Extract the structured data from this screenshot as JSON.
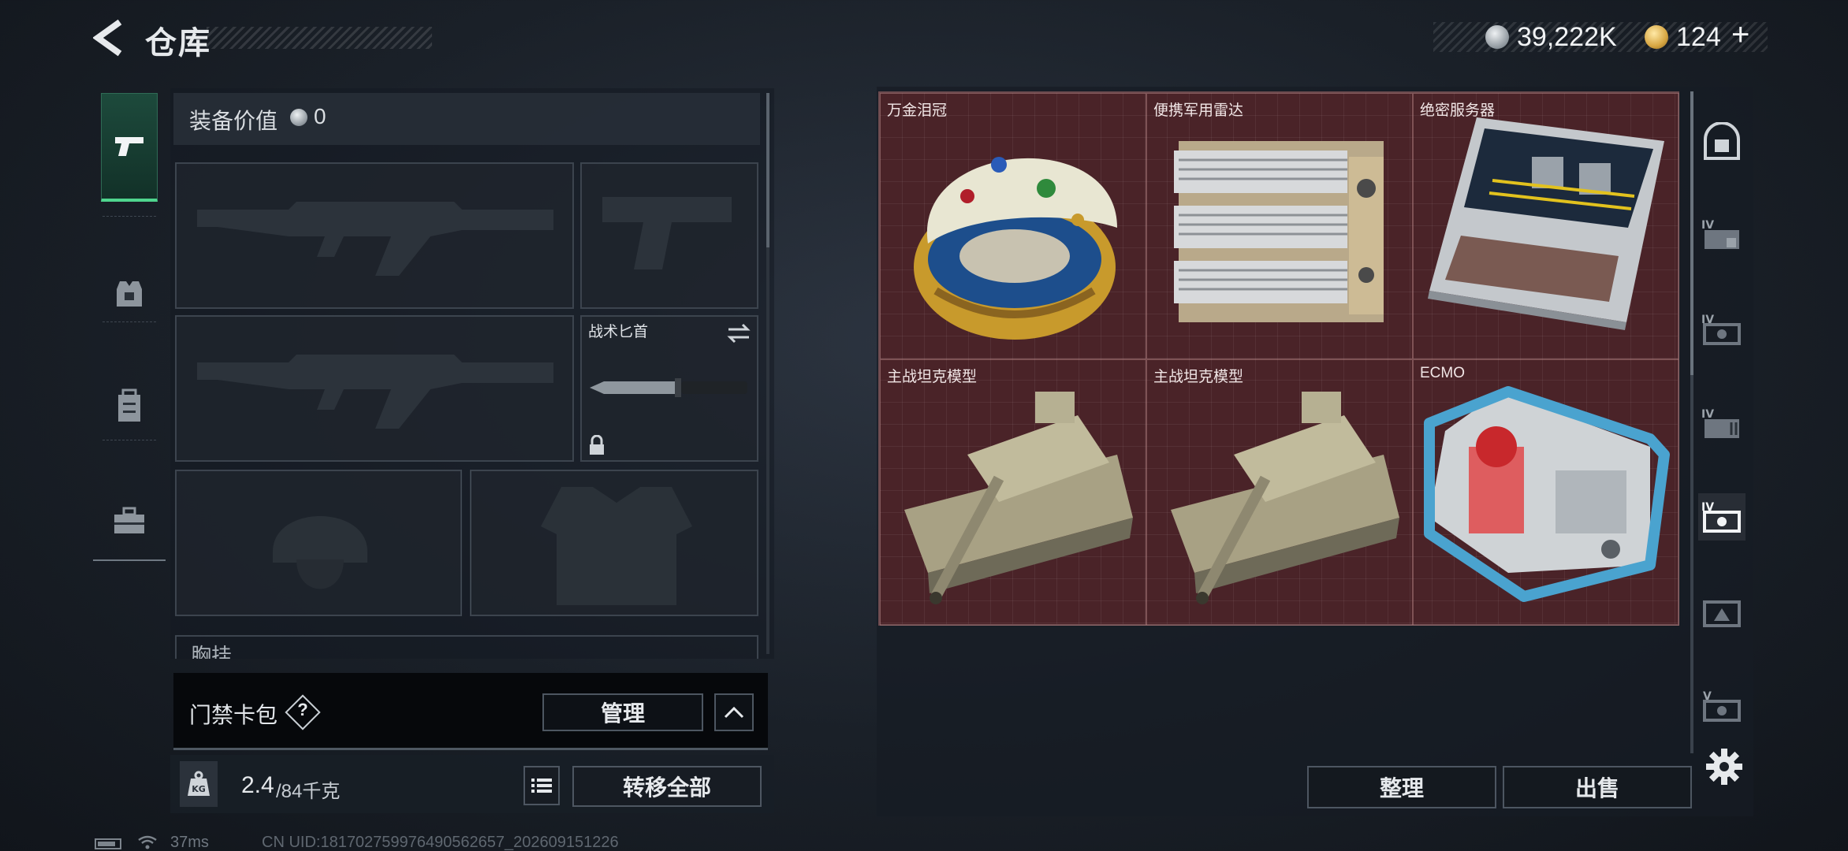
{
  "header": {
    "title": "仓库",
    "back_icon": "back-arrow-icon",
    "currency": [
      {
        "icon": "silver-coin-icon",
        "value": "39,222K"
      },
      {
        "icon": "gold-coin-icon",
        "value": "124"
      }
    ],
    "add_label": "+"
  },
  "left_nav": {
    "items": [
      {
        "icon": "pistol-icon",
        "active": true
      },
      {
        "icon": "armor-vest-icon",
        "active": false
      },
      {
        "icon": "backpack-icon",
        "active": false
      },
      {
        "icon": "toolbox-icon",
        "active": false
      }
    ]
  },
  "equipment": {
    "value_label": "装备价值",
    "value": "0",
    "slots": [
      {
        "id": "primary-1",
        "icon": "rifle-placeholder-icon"
      },
      {
        "id": "pistol",
        "icon": "pistol-placeholder-icon"
      },
      {
        "id": "primary-2",
        "icon": "rifle-placeholder-icon"
      },
      {
        "id": "knife",
        "label": "战术匕首",
        "icon": "knife-icon"
      },
      {
        "id": "helmet",
        "icon": "helmet-placeholder-icon"
      },
      {
        "id": "armor",
        "icon": "armor-placeholder-icon"
      }
    ],
    "chest_label": "胸挂"
  },
  "access_card": {
    "label": "门禁卡包",
    "help": "?",
    "manage_label": "管理"
  },
  "weight": {
    "current": "2.4",
    "max": "/84千克",
    "transfer_label": "转移全部"
  },
  "stash": {
    "items": [
      {
        "name": "万金泪冠",
        "icon": "jeweled-egg-icon"
      },
      {
        "name": "便携军用雷达",
        "icon": "portable-radar-icon"
      },
      {
        "name": "绝密服务器",
        "icon": "server-icon"
      },
      {
        "name": "主战坦克模型",
        "icon": "tank-model-icon"
      },
      {
        "name": "主战坦克模型",
        "icon": "tank-model-icon"
      },
      {
        "name": "ECMO",
        "icon": "ecmo-machine-icon"
      }
    ],
    "sort_label": "整理",
    "sell_label": "出售"
  },
  "side_nav": [
    "safe-box-icon",
    "container-iv-icon",
    "container-iv-icon",
    "container-iv-icon",
    "container-iv-icon",
    "container-icon",
    "container-v-icon"
  ],
  "status": {
    "ping": "37ms",
    "uid": "CN UID:181702759976490562657_202609151226"
  },
  "colors": {
    "accent_green": "#4fd58e",
    "grid_bg": "#4a2328",
    "panel_bg": "#1a2028"
  }
}
